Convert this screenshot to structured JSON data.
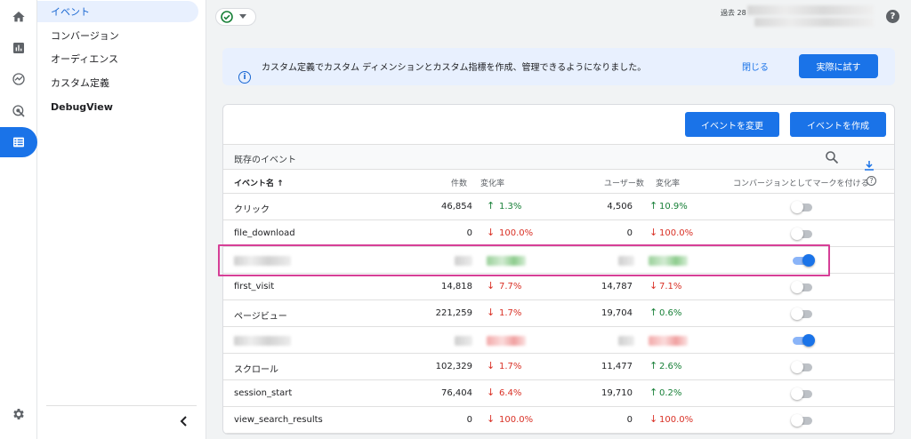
{
  "nav": {
    "items": [
      {
        "label": "イベント",
        "active": true
      },
      {
        "label": "コンバージョン"
      },
      {
        "label": "オーディエンス"
      },
      {
        "label": "カスタム定義"
      },
      {
        "label": "DebugView"
      }
    ]
  },
  "rail_icons": [
    "home-icon",
    "reports-icon",
    "explore-icon",
    "advertising-icon",
    "configure-icon",
    "settings-icon"
  ],
  "top": {
    "period_label": "過去 28"
  },
  "banner": {
    "text": "カスタム定義でカスタム ディメンションとカスタム指標を作成、管理できるようになりました。",
    "close": "閉じる",
    "try": "実際に試す"
  },
  "card": {
    "modify_button": "イベントを変更",
    "create_button": "イベントを作成",
    "section_title": "既存のイベント",
    "columns": {
      "name": "イベント名 ↑",
      "count": "件数",
      "change1": "変化率",
      "users": "ユーザー数",
      "change2": "変化率",
      "conversion": "コンバージョンとしてマークを付ける"
    }
  },
  "rows": [
    {
      "name": "クリック",
      "count": "46,854",
      "change": "1.3%",
      "dir": "up",
      "users": "4,506",
      "change2": "10.9%",
      "dir2": "up",
      "conversion": false
    },
    {
      "name": "file_download",
      "count": "0",
      "change": "100.0%",
      "dir": "down",
      "users": "0",
      "change2": "100.0%",
      "dir2": "down",
      "conversion": false
    },
    {
      "name": "",
      "count": "",
      "change": "",
      "dir": "blurred-green",
      "users": "",
      "change2": "",
      "dir2": "blurred-green",
      "conversion": true
    },
    {
      "name": "first_visit",
      "count": "14,818",
      "change": "7.7%",
      "dir": "down",
      "users": "14,787",
      "change2": "7.1%",
      "dir2": "down",
      "conversion": false
    },
    {
      "name": "ページビュー",
      "count": "221,259",
      "change": "1.7%",
      "dir": "down",
      "users": "19,704",
      "change2": "0.6%",
      "dir2": "up",
      "conversion": false
    },
    {
      "name": "",
      "count": "",
      "change": "",
      "dir": "blurred-red",
      "users": "",
      "change2": "",
      "dir2": "blurred-red",
      "conversion": true
    },
    {
      "name": "スクロール",
      "count": "102,329",
      "change": "1.7%",
      "dir": "down",
      "users": "11,477",
      "change2": "2.6%",
      "dir2": "up",
      "conversion": false
    },
    {
      "name": "session_start",
      "count": "76,404",
      "change": "6.4%",
      "dir": "down",
      "users": "19,710",
      "change2": "0.2%",
      "dir2": "up",
      "conversion": false
    },
    {
      "name": "view_search_results",
      "count": "0",
      "change": "100.0%",
      "dir": "down",
      "users": "0",
      "change2": "100.0%",
      "dir2": "down",
      "conversion": false
    }
  ],
  "colors": {
    "accent": "#1a73e8",
    "up": "#188038",
    "down": "#d93025",
    "highlight": "#d63f97"
  }
}
